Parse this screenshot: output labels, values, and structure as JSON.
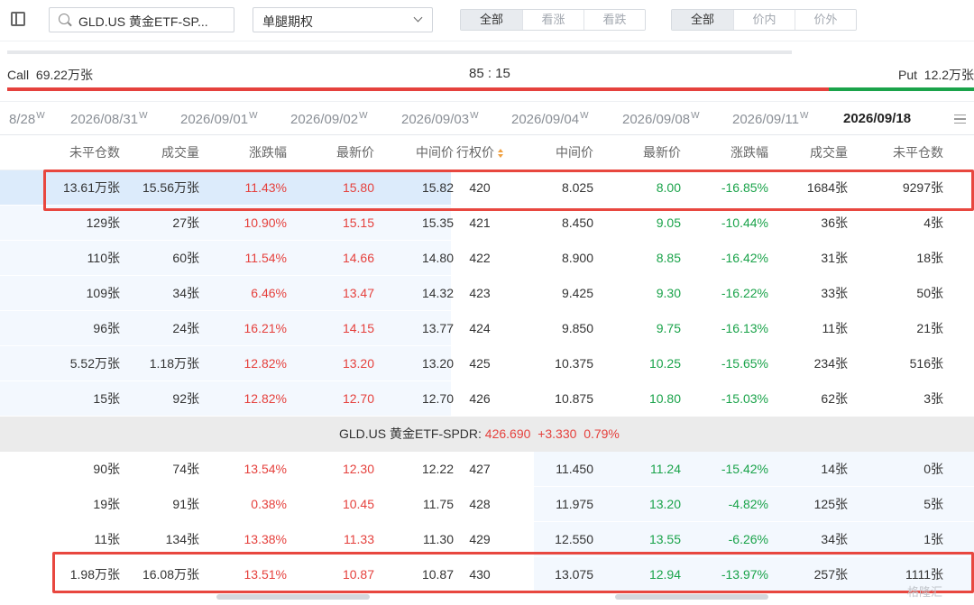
{
  "toolbar": {
    "search_value": "GLD.US 黄金ETF-SP...",
    "strategy_value": "单腿期权",
    "direction": {
      "options": [
        "全部",
        "看涨",
        "看跌"
      ],
      "active": 0
    },
    "moneyness": {
      "options": [
        "全部",
        "价内",
        "价外"
      ],
      "active": 0
    }
  },
  "ratio": {
    "call_label": "Call",
    "call_value": "69.22万张",
    "ratio_text": "85 : 15",
    "put_label": "Put",
    "put_value": "12.2万张",
    "call_fraction": 0.85,
    "colors": {
      "call": "#e5413d",
      "put": "#1aa34a"
    }
  },
  "expiries": {
    "dates": [
      "2026/08/28",
      "2026/08/31",
      "2026/09/01",
      "2026/09/02",
      "2026/09/03",
      "2026/09/04",
      "2026/09/08",
      "2026/09/11",
      "2026/09/18"
    ],
    "first_visible_fragment": "8/28",
    "weekly_marker": "W",
    "active_index": 8
  },
  "headers": {
    "call_oi": "未平仓数",
    "call_volume": "成交量",
    "call_change": "涨跌幅",
    "call_last": "最新价",
    "call_mid": "中间价",
    "strike": "行权价",
    "put_mid": "中间价",
    "put_last": "最新价",
    "put_change": "涨跌幅",
    "put_volume": "成交量",
    "put_oi": "未平仓数"
  },
  "rows_above": [
    {
      "c_oi": "13.61万张",
      "c_vol": "15.56万张",
      "c_chg": "11.43%",
      "c_last": "15.80",
      "c_mid": "15.82",
      "strike": "420",
      "p_mid": "8.025",
      "p_last": "8.00",
      "p_chg": "-16.85%",
      "p_vol": "1684张",
      "p_oi": "9297张"
    },
    {
      "c_oi": "129张",
      "c_vol": "27张",
      "c_chg": "10.90%",
      "c_last": "15.15",
      "c_mid": "15.35",
      "strike": "421",
      "p_mid": "8.450",
      "p_last": "9.05",
      "p_chg": "-10.44%",
      "p_vol": "36张",
      "p_oi": "4张"
    },
    {
      "c_oi": "110张",
      "c_vol": "60张",
      "c_chg": "11.54%",
      "c_last": "14.66",
      "c_mid": "14.80",
      "strike": "422",
      "p_mid": "8.900",
      "p_last": "8.85",
      "p_chg": "-16.42%",
      "p_vol": "31张",
      "p_oi": "18张"
    },
    {
      "c_oi": "109张",
      "c_vol": "34张",
      "c_chg": "6.46%",
      "c_last": "13.47",
      "c_mid": "14.32",
      "strike": "423",
      "p_mid": "9.425",
      "p_last": "9.30",
      "p_chg": "-16.22%",
      "p_vol": "33张",
      "p_oi": "50张"
    },
    {
      "c_oi": "96张",
      "c_vol": "24张",
      "c_chg": "16.21%",
      "c_last": "14.15",
      "c_mid": "13.77",
      "strike": "424",
      "p_mid": "9.850",
      "p_last": "9.75",
      "p_chg": "-16.13%",
      "p_vol": "11张",
      "p_oi": "21张"
    },
    {
      "c_oi": "5.52万张",
      "c_vol": "1.18万张",
      "c_chg": "12.82%",
      "c_last": "13.20",
      "c_mid": "13.20",
      "strike": "425",
      "p_mid": "10.375",
      "p_last": "10.25",
      "p_chg": "-15.65%",
      "p_vol": "234张",
      "p_oi": "516张"
    },
    {
      "c_oi": "15张",
      "c_vol": "92张",
      "c_chg": "12.82%",
      "c_last": "12.70",
      "c_mid": "12.70",
      "strike": "426",
      "p_mid": "10.875",
      "p_last": "10.80",
      "p_chg": "-15.03%",
      "p_vol": "62张",
      "p_oi": "3张"
    }
  ],
  "underlying": {
    "name": "GLD.US 黄金ETF-SPDR:",
    "price": "426.690",
    "change": "+3.330",
    "change_pct": "0.79%"
  },
  "rows_below": [
    {
      "c_oi": "90张",
      "c_vol": "74张",
      "c_chg": "13.54%",
      "c_last": "12.30",
      "c_mid": "12.22",
      "strike": "427",
      "p_mid": "11.450",
      "p_last": "11.24",
      "p_chg": "-15.42%",
      "p_vol": "14张",
      "p_oi": "0张"
    },
    {
      "c_oi": "19张",
      "c_vol": "91张",
      "c_chg": "0.38%",
      "c_last": "10.45",
      "c_mid": "11.75",
      "strike": "428",
      "p_mid": "11.975",
      "p_last": "13.20",
      "p_chg": "-4.82%",
      "p_vol": "125张",
      "p_oi": "5张"
    },
    {
      "c_oi": "11张",
      "c_vol": "134张",
      "c_chg": "13.38%",
      "c_last": "11.33",
      "c_mid": "11.30",
      "strike": "429",
      "p_mid": "12.550",
      "p_last": "13.55",
      "p_chg": "-6.26%",
      "p_vol": "34张",
      "p_oi": "1张"
    },
    {
      "c_oi": "1.98万张",
      "c_vol": "16.08万张",
      "c_chg": "13.51%",
      "c_last": "10.87",
      "c_mid": "10.87",
      "strike": "430",
      "p_mid": "13.075",
      "p_last": "12.94",
      "p_chg": "-13.97%",
      "p_vol": "257张",
      "p_oi": "1111张"
    }
  ],
  "watermark": "格隆汇"
}
